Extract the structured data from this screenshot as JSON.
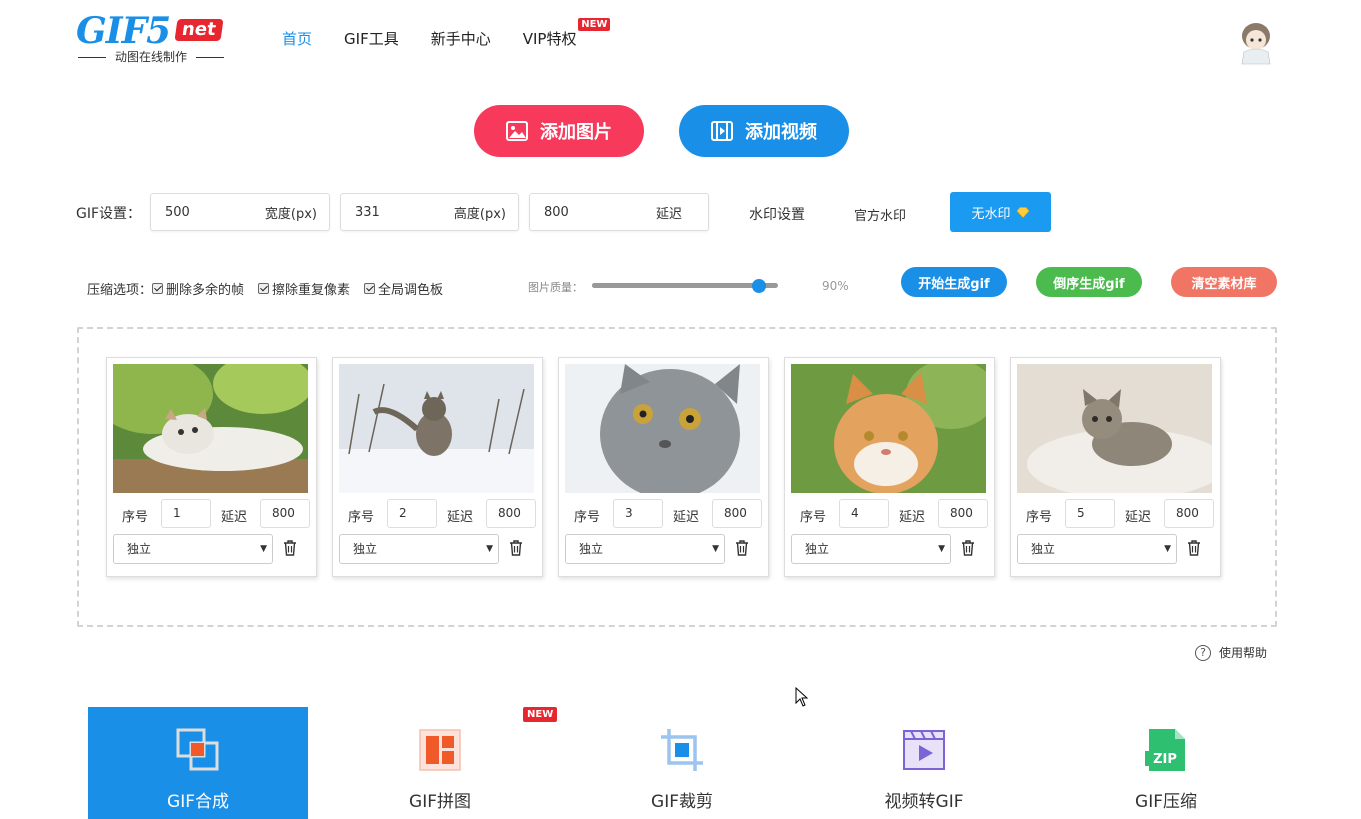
{
  "logo": {
    "main": "GIF5",
    "suffix": "net",
    "tagline": "动图在线制作"
  },
  "nav": [
    {
      "label": "首页",
      "active": true
    },
    {
      "label": "GIF工具",
      "active": false
    },
    {
      "label": "新手中心",
      "active": false
    },
    {
      "label": "VIP特权",
      "active": false,
      "badge": "NEW"
    }
  ],
  "upload": {
    "add_images": "添加图片",
    "add_video": "添加视频"
  },
  "gif_settings": {
    "label": "GIF设置：",
    "width": {
      "value": "500",
      "unit": "宽度(px)"
    },
    "height": {
      "value": "331",
      "unit": "高度(px)"
    },
    "delay": {
      "value": "800",
      "unit": "延迟"
    },
    "watermark_label": "水印设置",
    "official_watermark": "官方水印",
    "no_watermark": "无水印"
  },
  "compression": {
    "label": "压缩选项：",
    "options": [
      "删除多余的帧",
      "擦除重复像素",
      "全局调色板"
    ],
    "quality_label": "图片质量：",
    "quality_value": "90%",
    "quality_percent": 90
  },
  "actions": {
    "start": "开始生成gif",
    "reverse": "倒序生成gif",
    "clear": "清空素材库"
  },
  "frame_labels": {
    "order": "序号",
    "delay": "延迟"
  },
  "frames": [
    {
      "order": "1",
      "delay": "800",
      "mode": "独立"
    },
    {
      "order": "2",
      "delay": "800",
      "mode": "独立"
    },
    {
      "order": "3",
      "delay": "800",
      "mode": "独立"
    },
    {
      "order": "4",
      "delay": "800",
      "mode": "独立"
    },
    {
      "order": "5",
      "delay": "800",
      "mode": "独立"
    }
  ],
  "help": "使用帮助",
  "tools": [
    {
      "label": "GIF合成",
      "active": true,
      "icon": "merge-icon"
    },
    {
      "label": "GIF拼图",
      "active": false,
      "icon": "collage-icon",
      "badge": "NEW"
    },
    {
      "label": "GIF裁剪",
      "active": false,
      "icon": "crop-icon"
    },
    {
      "label": "视频转GIF",
      "active": false,
      "icon": "video-to-gif-icon"
    },
    {
      "label": "GIF压缩",
      "active": false,
      "icon": "zip-icon"
    }
  ],
  "colors": {
    "brand_blue": "#1a8fe8",
    "pink": "#f7395c",
    "green": "#4bbb4e",
    "salmon": "#f07565",
    "badge_red": "#e8262f"
  }
}
